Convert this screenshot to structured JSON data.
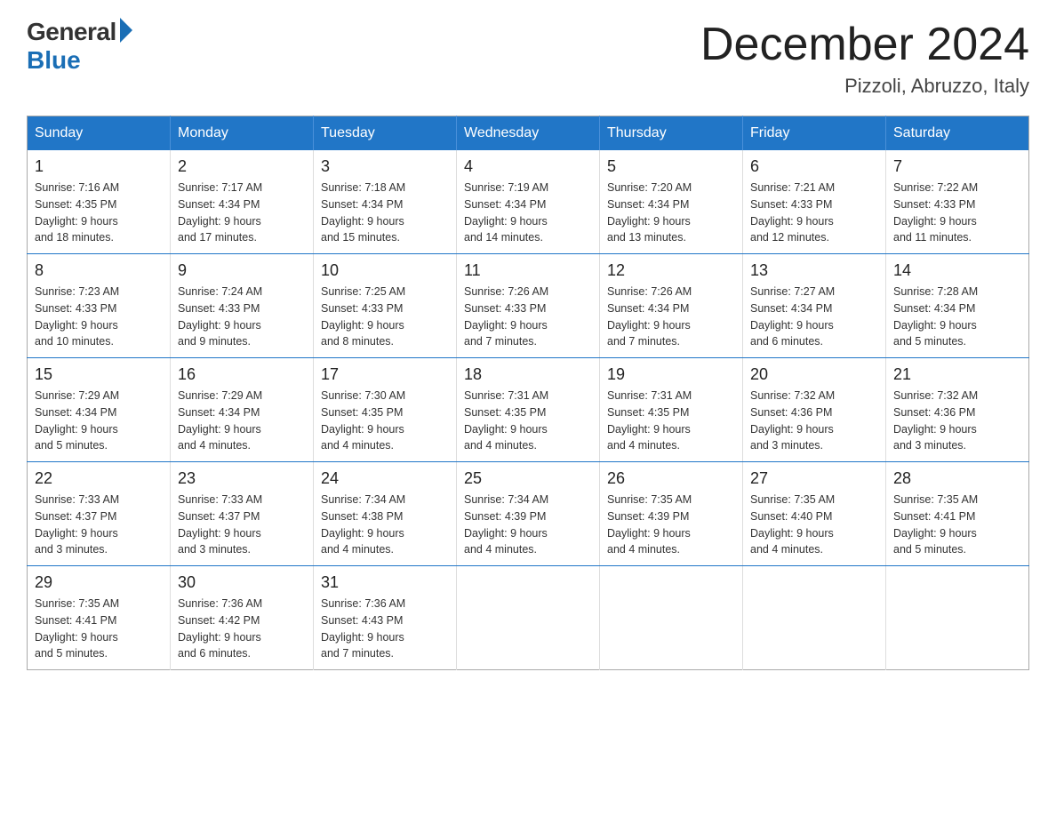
{
  "logo": {
    "general": "General",
    "blue": "Blue"
  },
  "title": "December 2024",
  "location": "Pizzoli, Abruzzo, Italy",
  "days_of_week": [
    "Sunday",
    "Monday",
    "Tuesday",
    "Wednesday",
    "Thursday",
    "Friday",
    "Saturday"
  ],
  "weeks": [
    [
      {
        "day": "1",
        "sunrise": "7:16 AM",
        "sunset": "4:35 PM",
        "daylight": "9 hours and 18 minutes."
      },
      {
        "day": "2",
        "sunrise": "7:17 AM",
        "sunset": "4:34 PM",
        "daylight": "9 hours and 17 minutes."
      },
      {
        "day": "3",
        "sunrise": "7:18 AM",
        "sunset": "4:34 PM",
        "daylight": "9 hours and 15 minutes."
      },
      {
        "day": "4",
        "sunrise": "7:19 AM",
        "sunset": "4:34 PM",
        "daylight": "9 hours and 14 minutes."
      },
      {
        "day": "5",
        "sunrise": "7:20 AM",
        "sunset": "4:34 PM",
        "daylight": "9 hours and 13 minutes."
      },
      {
        "day": "6",
        "sunrise": "7:21 AM",
        "sunset": "4:33 PM",
        "daylight": "9 hours and 12 minutes."
      },
      {
        "day": "7",
        "sunrise": "7:22 AM",
        "sunset": "4:33 PM",
        "daylight": "9 hours and 11 minutes."
      }
    ],
    [
      {
        "day": "8",
        "sunrise": "7:23 AM",
        "sunset": "4:33 PM",
        "daylight": "9 hours and 10 minutes."
      },
      {
        "day": "9",
        "sunrise": "7:24 AM",
        "sunset": "4:33 PM",
        "daylight": "9 hours and 9 minutes."
      },
      {
        "day": "10",
        "sunrise": "7:25 AM",
        "sunset": "4:33 PM",
        "daylight": "9 hours and 8 minutes."
      },
      {
        "day": "11",
        "sunrise": "7:26 AM",
        "sunset": "4:33 PM",
        "daylight": "9 hours and 7 minutes."
      },
      {
        "day": "12",
        "sunrise": "7:26 AM",
        "sunset": "4:34 PM",
        "daylight": "9 hours and 7 minutes."
      },
      {
        "day": "13",
        "sunrise": "7:27 AM",
        "sunset": "4:34 PM",
        "daylight": "9 hours and 6 minutes."
      },
      {
        "day": "14",
        "sunrise": "7:28 AM",
        "sunset": "4:34 PM",
        "daylight": "9 hours and 5 minutes."
      }
    ],
    [
      {
        "day": "15",
        "sunrise": "7:29 AM",
        "sunset": "4:34 PM",
        "daylight": "9 hours and 5 minutes."
      },
      {
        "day": "16",
        "sunrise": "7:29 AM",
        "sunset": "4:34 PM",
        "daylight": "9 hours and 4 minutes."
      },
      {
        "day": "17",
        "sunrise": "7:30 AM",
        "sunset": "4:35 PM",
        "daylight": "9 hours and 4 minutes."
      },
      {
        "day": "18",
        "sunrise": "7:31 AM",
        "sunset": "4:35 PM",
        "daylight": "9 hours and 4 minutes."
      },
      {
        "day": "19",
        "sunrise": "7:31 AM",
        "sunset": "4:35 PM",
        "daylight": "9 hours and 4 minutes."
      },
      {
        "day": "20",
        "sunrise": "7:32 AM",
        "sunset": "4:36 PM",
        "daylight": "9 hours and 3 minutes."
      },
      {
        "day": "21",
        "sunrise": "7:32 AM",
        "sunset": "4:36 PM",
        "daylight": "9 hours and 3 minutes."
      }
    ],
    [
      {
        "day": "22",
        "sunrise": "7:33 AM",
        "sunset": "4:37 PM",
        "daylight": "9 hours and 3 minutes."
      },
      {
        "day": "23",
        "sunrise": "7:33 AM",
        "sunset": "4:37 PM",
        "daylight": "9 hours and 3 minutes."
      },
      {
        "day": "24",
        "sunrise": "7:34 AM",
        "sunset": "4:38 PM",
        "daylight": "9 hours and 4 minutes."
      },
      {
        "day": "25",
        "sunrise": "7:34 AM",
        "sunset": "4:39 PM",
        "daylight": "9 hours and 4 minutes."
      },
      {
        "day": "26",
        "sunrise": "7:35 AM",
        "sunset": "4:39 PM",
        "daylight": "9 hours and 4 minutes."
      },
      {
        "day": "27",
        "sunrise": "7:35 AM",
        "sunset": "4:40 PM",
        "daylight": "9 hours and 4 minutes."
      },
      {
        "day": "28",
        "sunrise": "7:35 AM",
        "sunset": "4:41 PM",
        "daylight": "9 hours and 5 minutes."
      }
    ],
    [
      {
        "day": "29",
        "sunrise": "7:35 AM",
        "sunset": "4:41 PM",
        "daylight": "9 hours and 5 minutes."
      },
      {
        "day": "30",
        "sunrise": "7:36 AM",
        "sunset": "4:42 PM",
        "daylight": "9 hours and 6 minutes."
      },
      {
        "day": "31",
        "sunrise": "7:36 AM",
        "sunset": "4:43 PM",
        "daylight": "9 hours and 7 minutes."
      },
      null,
      null,
      null,
      null
    ]
  ],
  "labels": {
    "sunrise": "Sunrise:",
    "sunset": "Sunset:",
    "daylight": "Daylight:"
  }
}
